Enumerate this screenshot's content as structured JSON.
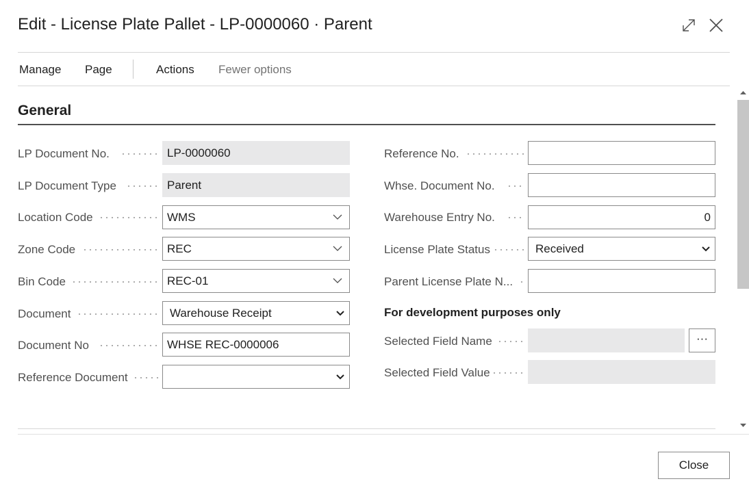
{
  "window": {
    "title": "Edit - License Plate Pallet - LP-0000060 · Parent",
    "expand_icon": "expand-icon",
    "close_icon": "close-icon"
  },
  "menu": {
    "items": [
      "Manage",
      "Page",
      "Actions",
      "Fewer options"
    ]
  },
  "section": {
    "title": "General"
  },
  "left_fields": [
    {
      "label": "LP Document No.",
      "value": "LP-0000060",
      "kind": "readonly"
    },
    {
      "label": "LP Document Type",
      "value": "Parent",
      "kind": "readonly"
    },
    {
      "label": "Location Code",
      "value": "WMS",
      "kind": "lookup"
    },
    {
      "label": "Zone Code",
      "value": "REC",
      "kind": "lookup"
    },
    {
      "label": "Bin Code",
      "value": "REC-01",
      "kind": "lookup"
    },
    {
      "label": "Document",
      "value": "Warehouse Receipt",
      "kind": "select"
    },
    {
      "label": "Document No",
      "value": "WHSE REC-0000006",
      "kind": "text"
    },
    {
      "label": "Reference Document",
      "value": "",
      "kind": "select"
    }
  ],
  "right_fields": [
    {
      "label": "Reference No.",
      "value": "",
      "kind": "text"
    },
    {
      "label": "Whse. Document No.",
      "value": "",
      "kind": "text"
    },
    {
      "label": "Warehouse Entry No.",
      "value": "0",
      "kind": "number"
    },
    {
      "label": "License Plate Status",
      "value": "Received",
      "kind": "select"
    },
    {
      "label": "Parent License Plate N...",
      "value": "",
      "kind": "text"
    }
  ],
  "dev": {
    "heading": "For development purposes only",
    "fields": [
      {
        "label": "Selected Field Name",
        "value": "",
        "kind": "readonly"
      },
      {
        "label": "Selected Field Value",
        "value": "",
        "kind": "readonly"
      }
    ],
    "ellipsis_label": "···"
  },
  "footer": {
    "close_label": "Close"
  }
}
